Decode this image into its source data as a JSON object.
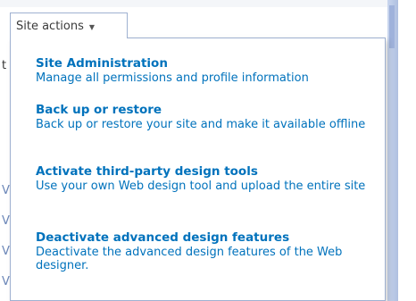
{
  "button": {
    "label": "Site actions",
    "caret": "▼"
  },
  "background": {
    "fragments": [
      "t",
      "V",
      "V",
      "V",
      "V"
    ]
  },
  "menu": {
    "items": [
      {
        "title": "Site Administration",
        "description": "Manage all permissions and profile information"
      },
      {
        "title": "Back up or restore",
        "description": "Back up or restore your site and make it available offline"
      },
      {
        "title": "Activate third-party design tools",
        "description": "Use your own Web design tool and upload the entire site"
      },
      {
        "title": "Deactivate advanced design features",
        "description": "Deactivate the advanced design features of the Web designer."
      }
    ]
  },
  "colors": {
    "link": "#0072bc",
    "border": "#9fb1d1"
  }
}
